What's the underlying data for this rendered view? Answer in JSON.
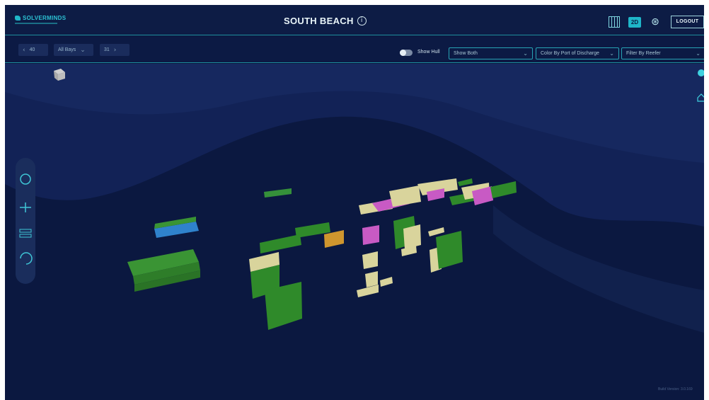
{
  "header": {
    "brand": "SOLVERMINDS",
    "title": "SOUTH BEACH",
    "two_d_label": "2D",
    "logout_label": "LOGOUT"
  },
  "toolbar": {
    "prev_bay": "40",
    "bays_select": "All Bays",
    "next_bay": "31",
    "show_hull_label": "Show Hull",
    "show_hull_on": false,
    "dropdown_view": "Show Both",
    "dropdown_color": "Color By Port of Discharge",
    "dropdown_filter": "Filter By Reefer"
  },
  "footer": {
    "version": "Build Version: 3.0.169"
  },
  "colors": {
    "background": "#0b1840",
    "accent": "#1fb6c8",
    "green": "#2f8a2a",
    "cream": "#d9d49c",
    "magenta": "#c85ac4",
    "orange": "#d0962e",
    "blue": "#1f7fc4"
  }
}
